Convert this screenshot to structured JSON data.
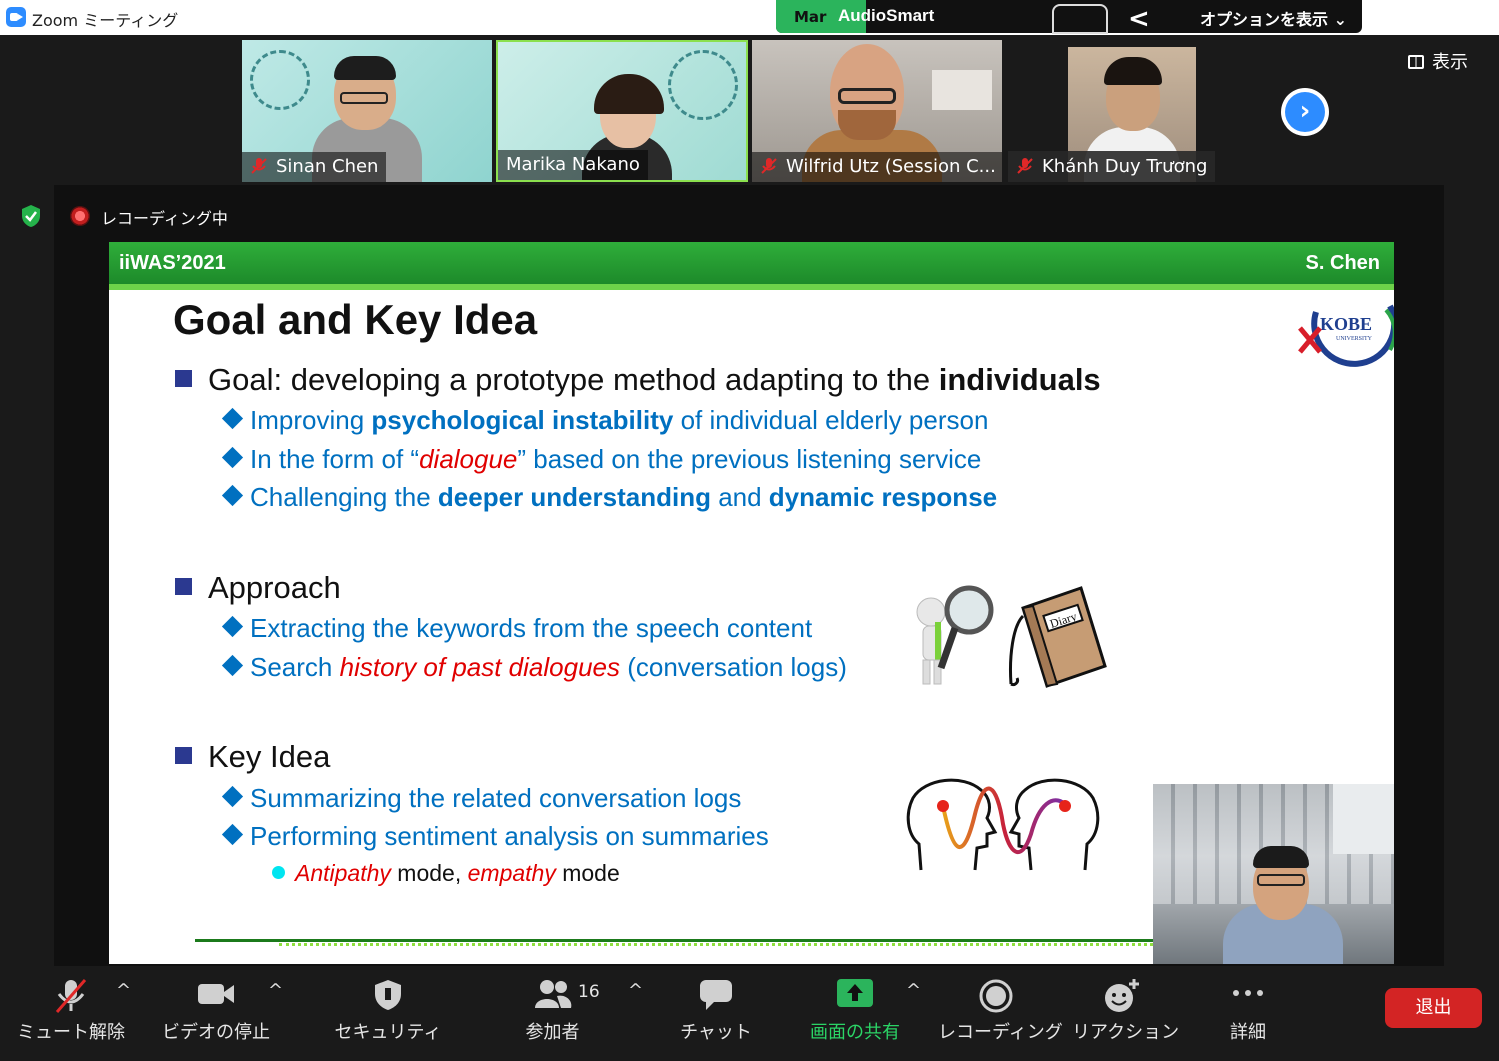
{
  "window": {
    "title": "Zoom ミーティング"
  },
  "share_toolbar": {
    "sharer_partial": "Mar",
    "app_name": "AudioSmart",
    "options_label": "オプションを表示 ⌄"
  },
  "participants": [
    {
      "name": "Sinan Chen",
      "muted": true
    },
    {
      "name": "Marika Nakano",
      "muted": false
    },
    {
      "name": "Wilfrid Utz (Session C...",
      "muted": true
    },
    {
      "name": "Khánh Duy Trương",
      "muted": true
    }
  ],
  "view_button": {
    "label": "表示"
  },
  "recording": {
    "label": "レコーディング中"
  },
  "slide": {
    "conference": "iiWAS’2021",
    "author": "S. Chen",
    "title": "Goal and Key Idea",
    "logo_text": "KOBE",
    "logo_subtext": "UNIVERSITY",
    "goal": {
      "prefix": "Goal: developing a prototype method adapting to the ",
      "bold": "individuals",
      "items": [
        {
          "a": "Improving ",
          "b": "psychological instability",
          "c": " of individual elderly person"
        },
        {
          "a": "In the form of “",
          "r": "dialogue",
          "c": "” based on the previous listening service"
        },
        {
          "a": "Challenging the ",
          "b": "deeper understanding",
          "m": " and ",
          "b2": "dynamic response"
        }
      ]
    },
    "approach": {
      "title": "Approach",
      "items": [
        {
          "a": "Extracting the keywords from the speech content"
        },
        {
          "a": "Search ",
          "r": "history of past dialogues",
          "c": " (conversation logs)"
        }
      ]
    },
    "diary_label": "Diary",
    "key_idea": {
      "title": "Key Idea",
      "items": [
        {
          "a": "Summarizing the related conversation logs"
        },
        {
          "a": "Performing sentiment analysis on summaries"
        }
      ],
      "modes": {
        "r1": "Antipathy",
        "t1": " mode, ",
        "r2": "empathy",
        "t2": " mode"
      }
    }
  },
  "toolbar": {
    "mute": "ミュート解除",
    "video": "ビデオの停止",
    "security": "セキュリティ",
    "participants": "参加者",
    "participants_count": "16",
    "chat": "チャット",
    "share": "画面の共有",
    "record": "レコーディング",
    "reactions": "リアクション",
    "more": "詳細",
    "leave": "退出"
  },
  "colors": {
    "zoom_blue": "#2d8cff",
    "share_green": "#2bb45c",
    "slide_green": "#2fae3a",
    "leave_red": "#d32424"
  }
}
